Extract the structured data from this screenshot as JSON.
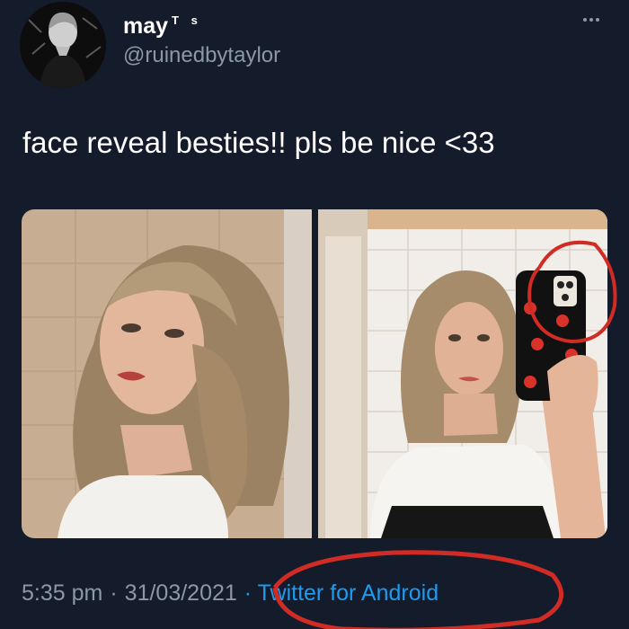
{
  "tweet": {
    "author": {
      "display_name": "may",
      "name_suffix": "T s",
      "handle": "@ruinedbytaylor",
      "avatar_icon": "profile-avatar-icon"
    },
    "more_icon": "more-options-icon",
    "text": "face reveal besties!! pls be nice <33",
    "media": [
      {
        "name": "photo-portrait"
      },
      {
        "name": "photo-mirror-selfie"
      }
    ],
    "time": "5:35 pm",
    "separator": "·",
    "date": "31/03/2021",
    "separator2": "·",
    "source": "Twitter for Android"
  },
  "colors": {
    "background": "#141b2a",
    "text_primary": "#ffffff",
    "text_secondary": "#8b98a5",
    "link": "#1d9bf0",
    "annotation": "#d02b25"
  }
}
